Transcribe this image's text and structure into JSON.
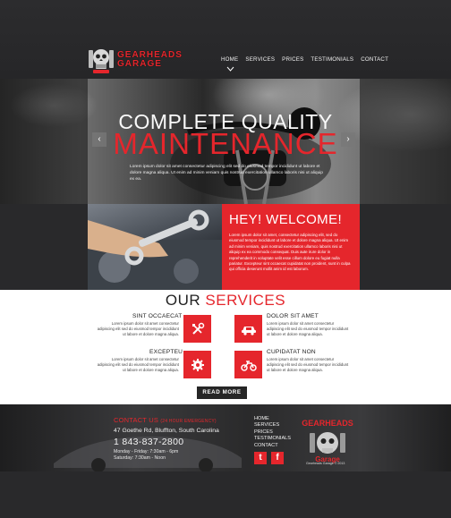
{
  "brand": {
    "line1": "GEARHEADS",
    "line2": "GARAGE"
  },
  "nav": {
    "items": [
      "HOME",
      "SERVICES",
      "PRICES",
      "TESTIMONIALS",
      "CONTACT"
    ],
    "active": "HOME"
  },
  "hero": {
    "title_line1": "COMPLETE QUALITY",
    "title_line2": "MAINTENANCE",
    "text": "Lorem ipsum dolor sit amet consectetur adipiscing elit sed do eiusmod tempor incididunt ut labore et dolore magna aliqua. Ut enim ad minim veniam quis nostrud exercitation ullamco laboris nisi ut aliquip ex ea.",
    "prev_label": "‹",
    "next_label": "›"
  },
  "welcome": {
    "title": "HEY! WELCOME!",
    "text": "Lorem ipsum dolor sit amet, consectetur adipiscing elit, sed do eiusmod tempor incididunt ut labore et dolore magna aliqua. Ut enim ad minim veniam, quis nostrud exercitation ullamco laboris nisi ut aliquip ex ea commodo consequat. Duis aute irure dolor in reprehenderit in voluptate velit esse cillum dolore eu fugiat nulla pariatur. Excepteur sint occaecat cupidatat non proident, sunt in culpa qui officia deserunt mollit anim id est laborum."
  },
  "services": {
    "title_plain": "OUR ",
    "title_accent": "SERVICES",
    "items": [
      {
        "title": "SINT OCCAECAT",
        "text": "Lorem ipsum dolor sit amet consectetur adipiscing elit sed do eiusmod tempor incididunt ut labore et dolore magna aliqua.",
        "icon": "tools-icon"
      },
      {
        "title": "DOLOR SIT AMET",
        "text": "Lorem ipsum dolor sit amet consectetur adipiscing elit sed do eiusmod tempor incididunt ut labore et dolore magna aliqua.",
        "icon": "car-icon"
      },
      {
        "title": "EXCEPTEU",
        "text": "Lorem ipsum dolor sit amet consectetur adipiscing elit sed do eiusmod tempor incididunt ut labore et dolore magna aliqua.",
        "icon": "gear-icon"
      },
      {
        "title": "CUPIDATAT NON",
        "text": "Lorem ipsum dolor sit amet consectetur adipiscing elit sed do eiusmod tempor incididunt ut labore et dolore magna aliqua.",
        "icon": "motorcycle-icon"
      }
    ],
    "read_more": "READ MORE"
  },
  "footer": {
    "contact_title": "CONTACT US",
    "contact_sub": "(24 HOUR EMERGENCY)",
    "address": "47 Goethe Rd, Bluffton, South Carolina",
    "phone": "1 843-837-2800",
    "hours1": "Monday - Friday: 7:30am - 6pm",
    "hours2": "Saturday: 7:30am - Noon",
    "nav": [
      "HOME",
      "SERVICES",
      "PRICES",
      "TESTIMONIALS",
      "CONTACT"
    ],
    "twitter": "t",
    "facebook": "f",
    "copyright": "Gearheads Garage © 2013"
  },
  "colors": {
    "accent": "#e5262c",
    "dark": "#29292b"
  }
}
